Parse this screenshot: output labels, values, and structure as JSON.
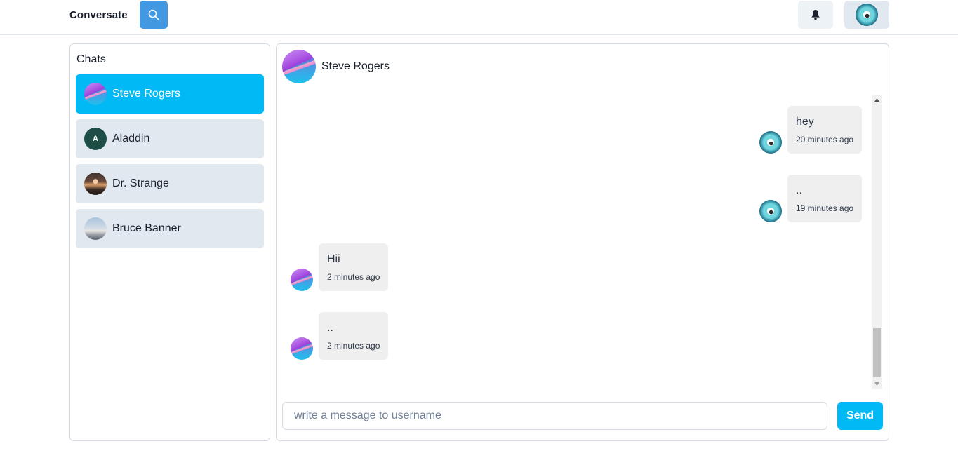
{
  "header": {
    "brand": "Conversate",
    "search_icon": "search-icon",
    "bell_icon": "bell-icon",
    "profile_avatar": "user-avatar"
  },
  "sidebar": {
    "title": "Chats",
    "items": [
      {
        "name": "Steve Rogers",
        "avatar": "image",
        "active": true
      },
      {
        "name": "Aladdin",
        "avatar_letter": "A",
        "active": false
      },
      {
        "name": "Dr. Strange",
        "avatar": "image",
        "active": false
      },
      {
        "name": "Bruce Banner",
        "avatar": "image",
        "active": false
      }
    ]
  },
  "conversation": {
    "contact_name": "Steve Rogers",
    "messages": [
      {
        "text": "hey",
        "time": "20 minutes ago",
        "from": "me"
      },
      {
        "text": "..",
        "time": "19 minutes ago",
        "from": "me"
      },
      {
        "text": "Hii",
        "time": "2 minutes ago",
        "from": "them"
      },
      {
        "text": "..",
        "time": "2 minutes ago",
        "from": "them"
      }
    ],
    "input_placeholder": "write a message to username",
    "input_value": "",
    "send_label": "Send"
  },
  "colors": {
    "accent": "#00b9f5",
    "search_button": "#4299e1",
    "item_bg": "#e2e8f0",
    "bubble_bg": "#efefef",
    "letter_avatar_bg": "#1d4d44"
  }
}
